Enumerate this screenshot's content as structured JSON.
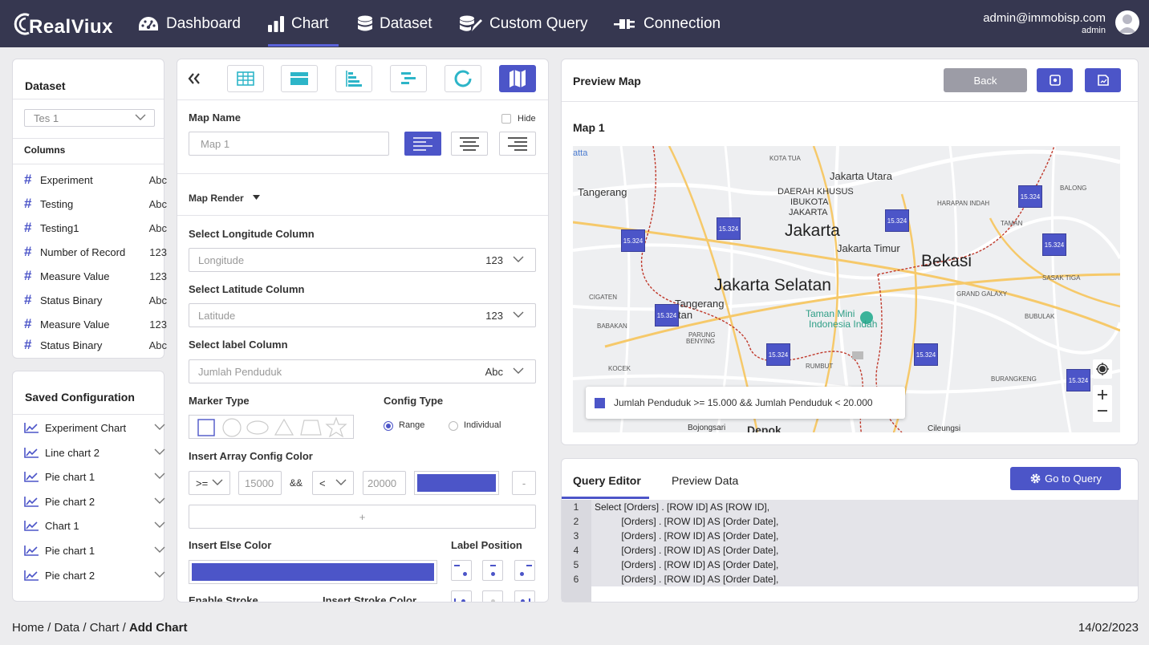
{
  "topbar": {
    "brand": "RealViux",
    "nav": [
      {
        "label": "Dashboard",
        "icon": "dashboard-icon"
      },
      {
        "label": "Chart",
        "icon": "bar-chart-icon",
        "active": true
      },
      {
        "label": "Dataset",
        "icon": "database-icon"
      },
      {
        "label": "Custom Query",
        "icon": "custom-query-icon"
      },
      {
        "label": "Connection",
        "icon": "plug-icon"
      }
    ],
    "user_email": "admin@immobisp.com",
    "user_role": "admin"
  },
  "dataset_panel": {
    "title": "Dataset",
    "selected": "Tes 1",
    "columns_title": "Columns",
    "columns": [
      {
        "name": "Experiment",
        "type": "Abc"
      },
      {
        "name": "Testing",
        "type": "Abc"
      },
      {
        "name": "Testing1",
        "type": "Abc"
      },
      {
        "name": "Number of Record",
        "type": "123"
      },
      {
        "name": "Measure Value",
        "type": "123"
      },
      {
        "name": "Status Binary",
        "type": "Abc"
      },
      {
        "name": "Measure Value",
        "type": "123"
      },
      {
        "name": "Status Binary",
        "type": "Abc"
      }
    ]
  },
  "saved_config": {
    "title": "Saved Configuration",
    "items": [
      "Experiment Chart",
      "Line chart 2",
      "Pie chart 1",
      "Pie chart 2",
      "Chart 1",
      "Pie chart 1",
      "Pie chart 2"
    ]
  },
  "config_panel": {
    "map_name_label": "Map Name",
    "hide_label": "Hide",
    "map_name_placeholder": "Map 1",
    "map_render_label": "Map Render",
    "longitude_label": "Select Longitude Column",
    "longitude_value": "Longitude",
    "longitude_type": "123",
    "latitude_label": "Select Latitude Column",
    "latitude_value": "Latitude",
    "latitude_type": "123",
    "label_column_label": "Select label Column",
    "label_column_value": "Jumlah Penduduk",
    "label_column_type": "Abc",
    "marker_type_label": "Marker Type",
    "config_type_label": "Config Type",
    "config_range": "Range",
    "config_individual": "Individual",
    "array_config_label": "Insert Array Config Color",
    "op1": ">=",
    "val1": "15000",
    "and_label": "&&",
    "op2": "<",
    "val2": "20000",
    "minus_label": "-",
    "plus_label": "+",
    "else_color_label": "Insert Else Color",
    "label_position_label": "Label Position",
    "enable_stroke_label": "Enable Stroke",
    "stroke_color_label": "Insert Stroke Color",
    "accent_color": "#4c55c8"
  },
  "preview": {
    "title": "Preview Map",
    "back_label": "Back",
    "map_title": "Map 1",
    "legend": "Jumlah Penduduk >= 15.000 && Jumlah Penduduk < 20.000",
    "marker_value": "15.324",
    "places": {
      "tangerang": "Tangerang",
      "kota_tua": "KOTA TUA",
      "jakarta_utara": "Jakarta Utara",
      "daerah1": "DAERAH KHUSUS",
      "daerah2": "IBUKOTA",
      "daerah3": "JAKARTA",
      "jakarta": "Jakarta",
      "jakarta_timur": "Jakarta Timur",
      "bekasi": "Bekasi",
      "jakarta_selatan": "Jakarta Selatan",
      "tangsel1": "Tangerang",
      "tangsel2": "tan",
      "taman_mini1": "Taman Mini",
      "taman_mini2": "Indonesia Indah",
      "balong": "BALONG",
      "harapan": "HARAPAN INDAH",
      "taman": "TAMAN",
      "sasak": "SASAK TIGA",
      "grand": "GRAND GALAXY",
      "bubulak": "BUBULAK",
      "burangkeng": "BURANGKENG",
      "cigaten": "CIGATEN",
      "babakan": "BABAKAN",
      "parung": "PARUNG",
      "benying": "BENYING",
      "kocek": "KOCEK",
      "rumbut": "RUMBUT",
      "bojongsari": "Bojongsari",
      "depok": "Depok",
      "cileungsi": "Cileungsi",
      "atta": "atta"
    }
  },
  "query": {
    "tab_editor": "Query Editor",
    "tab_preview": "Preview Data",
    "go_label": "Go to Query",
    "lines": [
      {
        "n": "1",
        "text": "Select [Orders] . [ROW ID] AS [ROW ID],"
      },
      {
        "n": "2",
        "text": "          [Orders] . [ROW ID] AS [Order Date],"
      },
      {
        "n": "3",
        "text": "          [Orders] . [ROW ID] AS [Order Date],"
      },
      {
        "n": "4",
        "text": "          [Orders] . [ROW ID] AS [Order Date],"
      },
      {
        "n": "5",
        "text": "          [Orders] . [ROW ID] AS [Order Date],"
      },
      {
        "n": "6",
        "text": "          [Orders] . [ROW ID] AS [Order Date],"
      }
    ]
  },
  "footer": {
    "crumb1": "Home",
    "crumb2": "Data",
    "crumb3": "Chart",
    "crumb4": "Add Chart",
    "sep": " / ",
    "date": "14/02/2023"
  }
}
